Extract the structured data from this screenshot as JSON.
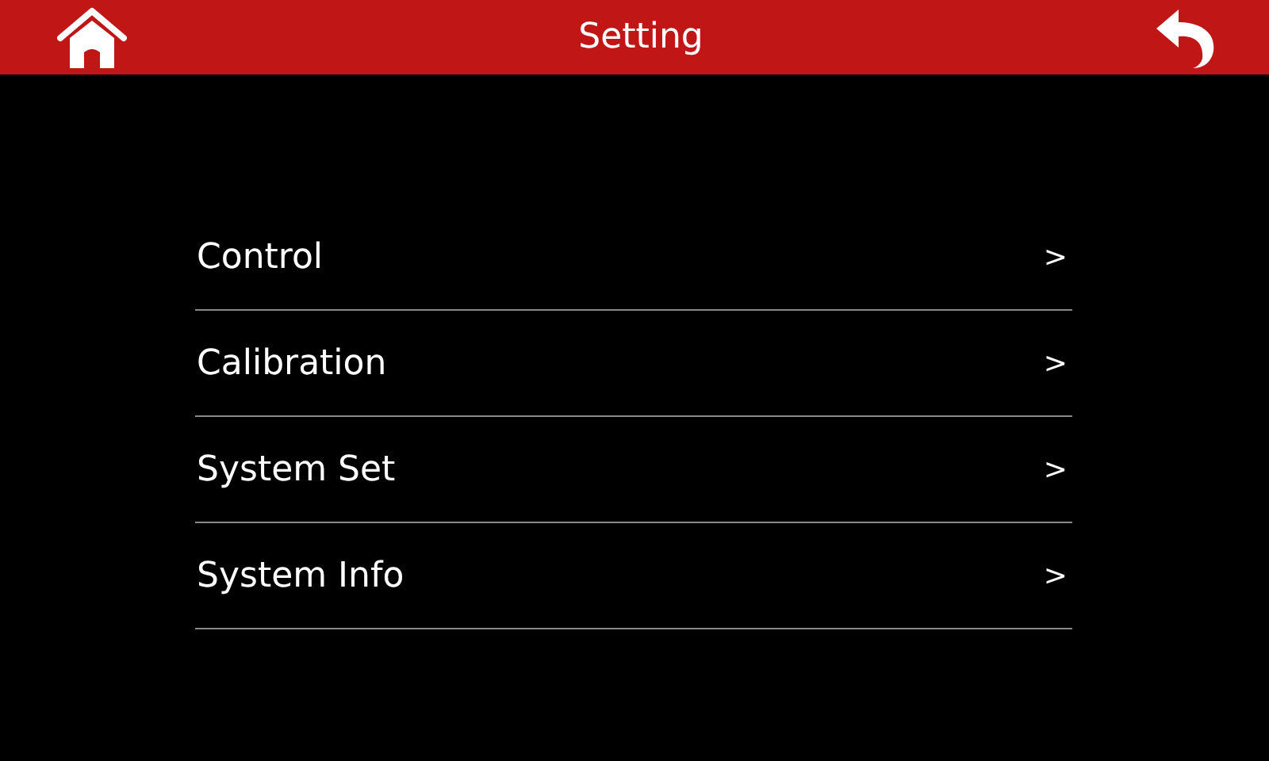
{
  "header": {
    "title": "Setting"
  },
  "menu": [
    {
      "label": "Control",
      "arrow": ">"
    },
    {
      "label": "Calibration",
      "arrow": ">"
    },
    {
      "label": "System Set",
      "arrow": ">"
    },
    {
      "label": "System Info",
      "arrow": ">"
    }
  ]
}
